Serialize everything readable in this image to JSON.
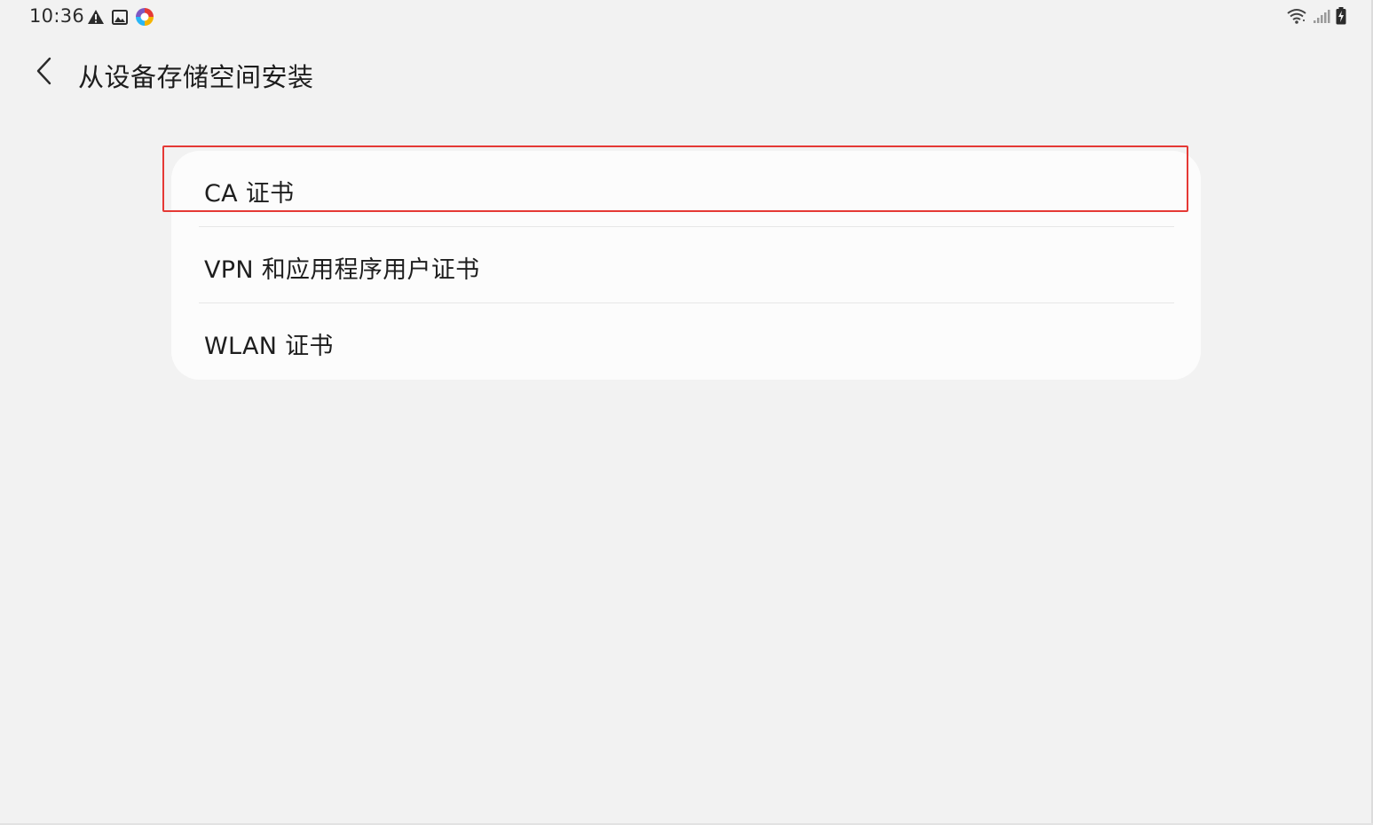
{
  "status_bar": {
    "time": "10:36",
    "left_icons": [
      "warning-icon",
      "image-icon",
      "app-badge-icon"
    ],
    "right_icons": [
      "wifi-icon",
      "signal-icon",
      "battery-charging-icon"
    ]
  },
  "header": {
    "title": "从设备存储空间安装"
  },
  "list": {
    "items": [
      {
        "label": "CA 证书"
      },
      {
        "label": "VPN 和应用程序用户证书"
      },
      {
        "label": "WLAN 证书"
      }
    ]
  },
  "colors": {
    "background": "#f2f2f2",
    "card": "#fcfcfc",
    "highlight": "#e53935",
    "text": "#1e1e1e"
  }
}
